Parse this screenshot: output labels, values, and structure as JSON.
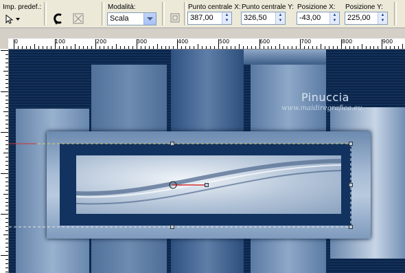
{
  "toolbar": {
    "preset_label": "Imp. predef.:",
    "mode_label": "Modalità:",
    "mode_value": "Scala",
    "center_x_label": "Punto centrale X:",
    "center_x_value": "387,00",
    "center_y_label": "Punto centrale Y:",
    "center_y_value": "326,50",
    "pos_x_label": "Posizione X:",
    "pos_x_value": "-43,00",
    "pos_y_label": "Posizione Y:",
    "pos_y_value": "225,00"
  },
  "ruler": {
    "labels": [
      "0",
      "100",
      "200",
      "300",
      "400",
      "500",
      "600",
      "700",
      "800",
      "900"
    ]
  },
  "canvas": {
    "watermark_title": "Pinuccia",
    "watermark_url": "www.maidiregrafica.eu"
  },
  "colors": {
    "background_navy": "#0e2c57",
    "panel_blue": "#7d97b8",
    "toolbar_bg": "#ece9d8"
  }
}
